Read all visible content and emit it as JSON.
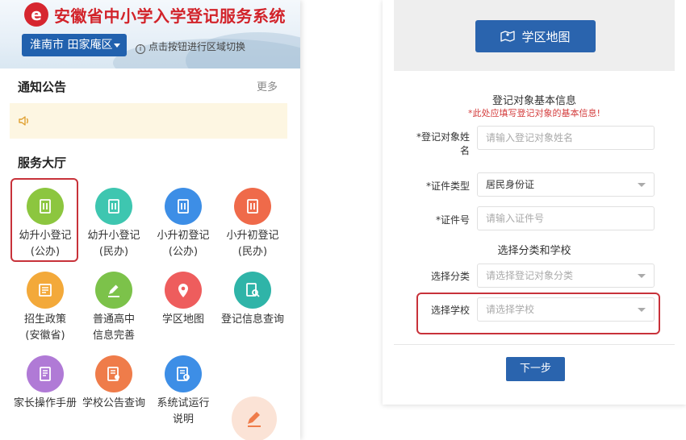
{
  "left": {
    "header": {
      "logo_glyph": "e",
      "title": "安徽省中小学入学登记服务系统",
      "region_button": "淮南市 田家庵区",
      "region_tip": "点击按钮进行区域切换"
    },
    "notice": {
      "title": "通知公告",
      "more": "更多"
    },
    "service_hall": {
      "title": "服务大厅",
      "tiles": [
        {
          "line1": "幼升小登记",
          "line2": "(公办)",
          "icon": "book-icon",
          "color": "#8cc63f"
        },
        {
          "line1": "幼升小登记",
          "line2": "(民办)",
          "icon": "book-icon",
          "color": "#3ec6b0"
        },
        {
          "line1": "小升初登记",
          "line2": "(公办)",
          "icon": "book-icon",
          "color": "#3d8ee6"
        },
        {
          "line1": "小升初登记",
          "line2": "(民办)",
          "icon": "book-icon",
          "color": "#ef6a4a"
        },
        {
          "line1": "招生政策",
          "line2": "(安徽省)",
          "icon": "newspaper-icon",
          "color": "#f3a93a"
        },
        {
          "line1": "普通高中",
          "line2": "信息完善",
          "icon": "pencil-icon",
          "color": "#7cc24a"
        },
        {
          "line1": "学区地图",
          "line2": "",
          "icon": "map-pin-icon",
          "color": "#ee5d5d"
        },
        {
          "line1": "登记信息查询",
          "line2": "",
          "icon": "search-doc-icon",
          "color": "#2fb4a8"
        },
        {
          "line1": "家长操作手册",
          "line2": "",
          "icon": "manual-icon",
          "color": "#b07ad6"
        },
        {
          "line1": "学校公告查询",
          "line2": "",
          "icon": "notice-doc-icon",
          "color": "#ef7c4a"
        },
        {
          "line1": "系统试运行",
          "line2": "说明",
          "icon": "settings-doc-icon",
          "color": "#3d8ee6"
        }
      ]
    }
  },
  "right": {
    "map_button": "学区地图",
    "basic_info": {
      "title": "登记对象基本信息",
      "hint": "*此处应填写登记对象的基本信息!",
      "name_label_1": "*登记对象姓",
      "name_label_2": "名",
      "name_placeholder": "请输入登记对象姓名",
      "id_type_label": "*证件类型",
      "id_type_value": "居民身份证",
      "id_no_label": "*证件号",
      "id_no_placeholder": "请输入证件号"
    },
    "category": {
      "title": "选择分类和学校",
      "category_label": "选择分类",
      "category_placeholder": "请选择登记对象分类",
      "school_label": "选择学校",
      "school_placeholder": "请选择学校"
    },
    "next_button": "下一步"
  },
  "colors": {
    "brand_red": "#d2232a",
    "primary_blue": "#2a64ae",
    "highlight_red": "#c8323a",
    "notice_bg": "#fdf6e2"
  }
}
